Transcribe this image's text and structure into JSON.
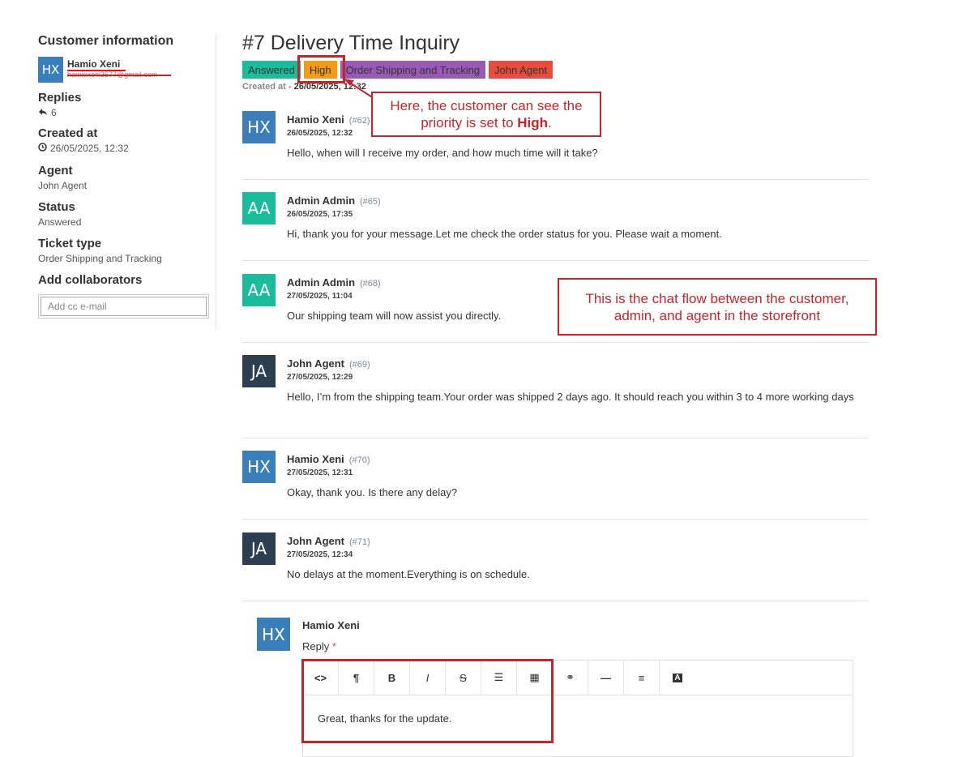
{
  "sidebar": {
    "title": "Customer information",
    "customer": {
      "initials": "HX",
      "name": "Hamio Xeni",
      "email": "hamioxeni3577@gmail.com"
    },
    "replies": {
      "label": "Replies",
      "value": "6",
      "icon": "reply-icon"
    },
    "created": {
      "label": "Created at",
      "value": "26/05/2025, 12:32",
      "icon": "clock-icon"
    },
    "agent": {
      "label": "Agent",
      "value": "John Agent"
    },
    "status": {
      "label": "Status",
      "value": "Answered"
    },
    "ticket_type": {
      "label": "Ticket type",
      "value": "Order Shipping and Tracking"
    },
    "collaborators": {
      "label": "Add collaborators",
      "placeholder": "Add cc e-mail"
    }
  },
  "ticket": {
    "title": "#7 Delivery Time Inquiry",
    "tags": [
      {
        "label": "Answered",
        "color": "#1abc9c"
      },
      {
        "label": "High",
        "color": "#f39c12"
      },
      {
        "label": "Order Shipping and Tracking",
        "color": "#9b59b6"
      },
      {
        "label": "John Agent",
        "color": "#e74c3c"
      }
    ],
    "created_prefix": "Created at - ",
    "created_value": "26/05/2025, 12:32"
  },
  "messages": [
    {
      "initials": "HX",
      "name": "Hamio Xeni",
      "id": "(#62)",
      "date": "26/05/2025, 12:32",
      "text": "Hello, when will I receive my order, and how much time will it take?",
      "color": "#3a7fb9"
    },
    {
      "initials": "AA",
      "name": "Admin Admin",
      "id": "(#65)",
      "date": "26/05/2025, 17:35",
      "text": "Hi, thank you for your message.Let me check the order status for you. Please wait a moment.",
      "color": "#1abc9c"
    },
    {
      "initials": "AA",
      "name": "Admin Admin",
      "id": "(#68)",
      "date": "27/05/2025, 11:04",
      "text": "Our shipping team will now assist you directly.",
      "color": "#1abc9c"
    },
    {
      "initials": "JA",
      "name": "John Agent",
      "id": "(#69)",
      "date": "27/05/2025, 12:29",
      "text": "Hello, I’m from the shipping team.Your order was shipped 2 days ago. It should reach you within 3 to 4 more working days",
      "color": "#2c3e50"
    },
    {
      "initials": "HX",
      "name": "Hamio Xeni",
      "id": "(#70)",
      "date": "27/05/2025, 12:31",
      "text": "Okay, thank you. Is there any delay?",
      "color": "#3a7fb9"
    },
    {
      "initials": "JA",
      "name": "John Agent",
      "id": "(#71)",
      "date": "27/05/2025, 12:34",
      "text": "No delays at the moment.Everything is on schedule.",
      "color": "#2c3e50"
    }
  ],
  "reply": {
    "initials": "HX",
    "name": "Hamio Xeni",
    "label": "Reply",
    "required_mark": "*",
    "content": "Great, thanks for the update.",
    "toolbar": [
      {
        "name": "code-view",
        "glyph": "<>"
      },
      {
        "name": "paragraph",
        "glyph": "¶"
      },
      {
        "name": "bold",
        "glyph": "B"
      },
      {
        "name": "italic",
        "glyph": "I"
      },
      {
        "name": "strikethrough",
        "glyph": "S"
      },
      {
        "name": "bullet-list",
        "glyph": "☰"
      },
      {
        "name": "table",
        "glyph": "▦"
      },
      {
        "name": "link",
        "glyph": "⚭"
      },
      {
        "name": "horizontal-rule",
        "glyph": "—"
      },
      {
        "name": "align",
        "glyph": "≡"
      },
      {
        "name": "text-color",
        "glyph": "A"
      }
    ]
  },
  "annotations": {
    "priority_note_line1": "Here, the customer can see the",
    "priority_note_line2_prefix": "priority is set to ",
    "priority_note_line2_bold": "High",
    "priority_note_line2_suffix": ".",
    "chat_note_line1": "This is the chat flow between the customer,",
    "chat_note_line2": "admin, and agent in the storefront",
    "color": "#c0272d"
  }
}
